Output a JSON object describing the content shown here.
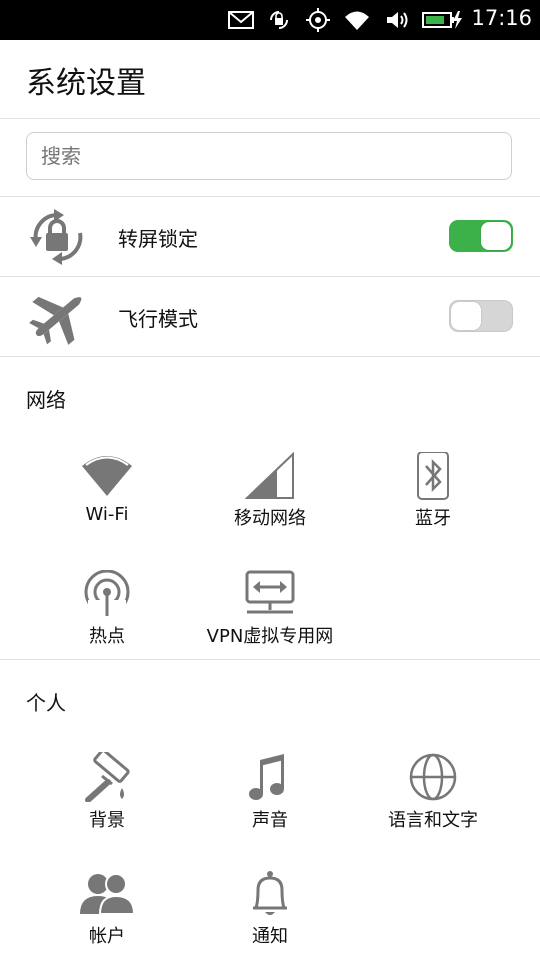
{
  "status_bar": {
    "time": "17:16",
    "icons": [
      "mail-icon",
      "rotation-lock-icon",
      "location-icon",
      "wifi-icon",
      "volume-icon",
      "battery-charging-icon"
    ]
  },
  "header": {
    "title": "系统设置"
  },
  "search": {
    "placeholder": "搜索"
  },
  "quick_toggles": [
    {
      "label": "转屏锁定",
      "icon": "rotation-lock-icon",
      "state": "on"
    },
    {
      "label": "飞行模式",
      "icon": "airplane-icon",
      "state": "off"
    }
  ],
  "sections": {
    "network": {
      "title": "网络",
      "items": [
        {
          "label": "Wi-Fi",
          "icon": "wifi-icon"
        },
        {
          "label": "移动网络",
          "icon": "cellular-signal-icon"
        },
        {
          "label": "蓝牙",
          "icon": "bluetooth-icon"
        },
        {
          "label": "热点",
          "icon": "hotspot-icon"
        },
        {
          "label": "VPN虚拟专用网",
          "icon": "vpn-icon"
        }
      ]
    },
    "personal": {
      "title": "个人",
      "items": [
        {
          "label": "背景",
          "icon": "paint-roller-icon"
        },
        {
          "label": "声音",
          "icon": "music-note-icon"
        },
        {
          "label": "语言和文字",
          "icon": "globe-icon"
        },
        {
          "label": "帐户",
          "icon": "accounts-icon"
        },
        {
          "label": "通知",
          "icon": "bell-icon"
        }
      ]
    }
  },
  "colors": {
    "toggle_on": "#3cb14a",
    "toggle_off": "#d6d6d6",
    "icon_gray": "#777777"
  }
}
